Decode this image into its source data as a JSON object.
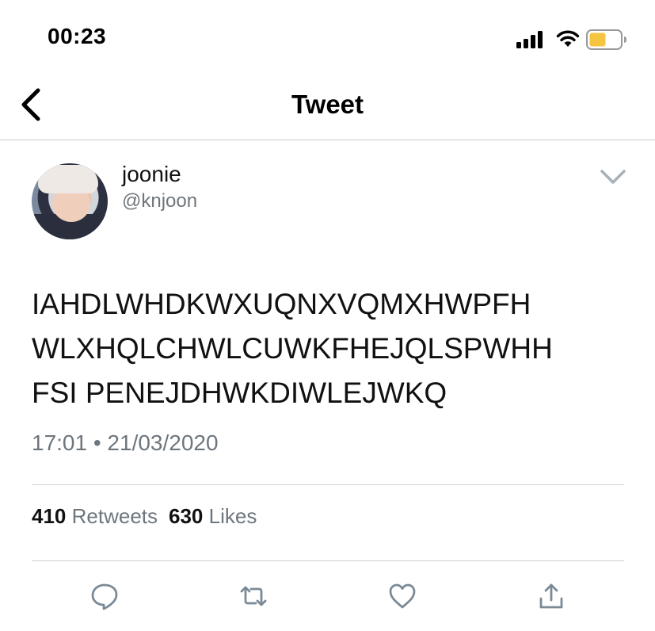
{
  "status_bar": {
    "time": "00:23",
    "battery_color": "#f5c542",
    "icons": [
      "signal-icon",
      "wifi-icon",
      "battery-icon"
    ]
  },
  "header": {
    "title": "Tweet",
    "back_icon": "chevron-left-icon"
  },
  "tweet": {
    "author": {
      "display_name": "joonie",
      "handle": "@knjoon",
      "menu_icon": "chevron-down-icon"
    },
    "text": "IAHDLWHDKWXUQNXVQMXHWPFH WLXHQLCHWLCUWKFHEJQLSPWHH FSI PENEJDHWKDIWLEJWKQ",
    "lines": [
      "IAHDLWHDKWXUQNXVQMXHWPFH",
      "WLXHQLCHWLCUWKFHEJQLSPWHH",
      "FSI PENEJDHWKDIWLEJWKQ"
    ],
    "timestamp": "17:01 • 21/03/2020",
    "stats": {
      "retweets_count": "410",
      "retweets_label": "Retweets",
      "likes_count": "630",
      "likes_label": "Likes"
    }
  },
  "actions": [
    {
      "name": "reply",
      "icon": "reply-bubble-icon"
    },
    {
      "name": "retweet",
      "icon": "retweet-icon"
    },
    {
      "name": "like",
      "icon": "heart-icon"
    },
    {
      "name": "share",
      "icon": "share-icon"
    }
  ],
  "colors": {
    "text_primary": "#111111",
    "text_secondary": "#6e767d",
    "divider": "#d0d0d0",
    "icon_gray": "#7b8a97"
  }
}
